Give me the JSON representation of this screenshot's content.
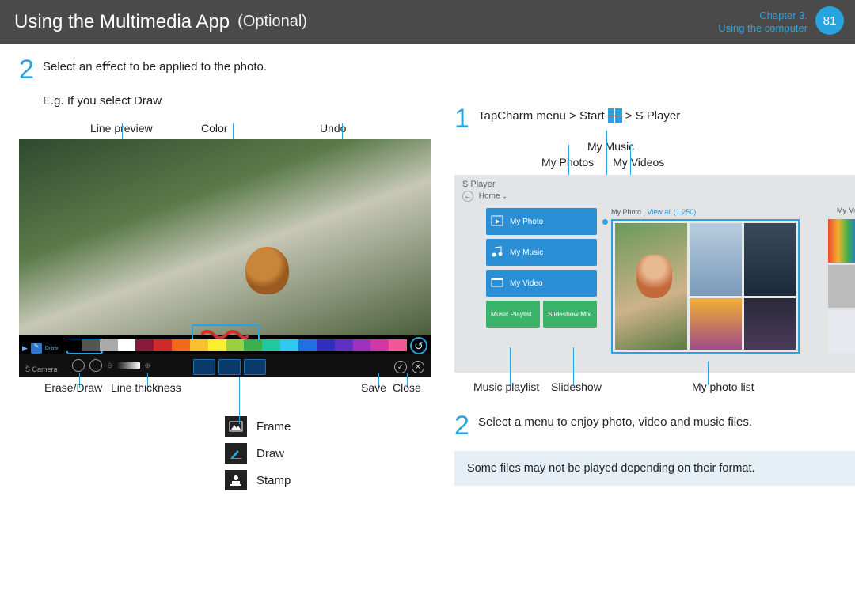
{
  "header": {
    "title": "Using the Multimedia App",
    "subtitle": "(Optional)",
    "chapter": "Chapter 3.",
    "section": "Using the computer",
    "page": "81"
  },
  "left": {
    "step2_num": "2",
    "step2_text": "Select an eﬀect to be applied to the photo.",
    "eg": "E.g. If you select Draw",
    "top_labels": {
      "line_preview": "Line preview",
      "color": "Color",
      "undo": "Undo"
    },
    "app_name": "S Camera",
    "mini_tabs": {
      "frame": "Frame",
      "draw": "Draw",
      "stamp": "Stamp"
    },
    "bottom_labels": {
      "erase": "Erase/Draw",
      "thickness": "Line thickness",
      "save": "Save",
      "close": "Close"
    },
    "icon_list": {
      "frame": "Frame",
      "draw": "Draw",
      "stamp": "Stamp"
    }
  },
  "right": {
    "step1_num": "1",
    "step1_a": "TapCharm menu > Start",
    "step1_b": " > S Player",
    "sub_labels": {
      "my_music": "My Music",
      "my_photos": "My Photos",
      "my_videos": "My Videos"
    },
    "splayer": {
      "title": "S Player",
      "home": "Home",
      "photo_heading": "My Photo",
      "view_all": "| View all (1,250)",
      "my_mu": "My Mu",
      "tiles": {
        "photo": "My Photo",
        "music": "My Music",
        "video": "My Video",
        "playlist": "Music Playlist",
        "slideshow": "Slideshow Mix"
      }
    },
    "bottom_labels": {
      "playlist": "Music playlist",
      "slideshow": "Slideshow",
      "photo_list": "My photo list"
    },
    "step2_num": "2",
    "step2_text": "Select a menu to enjoy photo, video and music ﬁles.",
    "note": "Some ﬁles may not be played depending on their format."
  },
  "palette": [
    "#000",
    "#555",
    "#aaa",
    "#fff",
    "#8a1a3a",
    "#d02a2a",
    "#f06a1a",
    "#f8c030",
    "#f8f030",
    "#9ad040",
    "#3ab04a",
    "#20c8a0",
    "#30c8f0",
    "#2070e0",
    "#3030b8",
    "#6030c0",
    "#a030c0",
    "#d038a8",
    "#f05898"
  ]
}
